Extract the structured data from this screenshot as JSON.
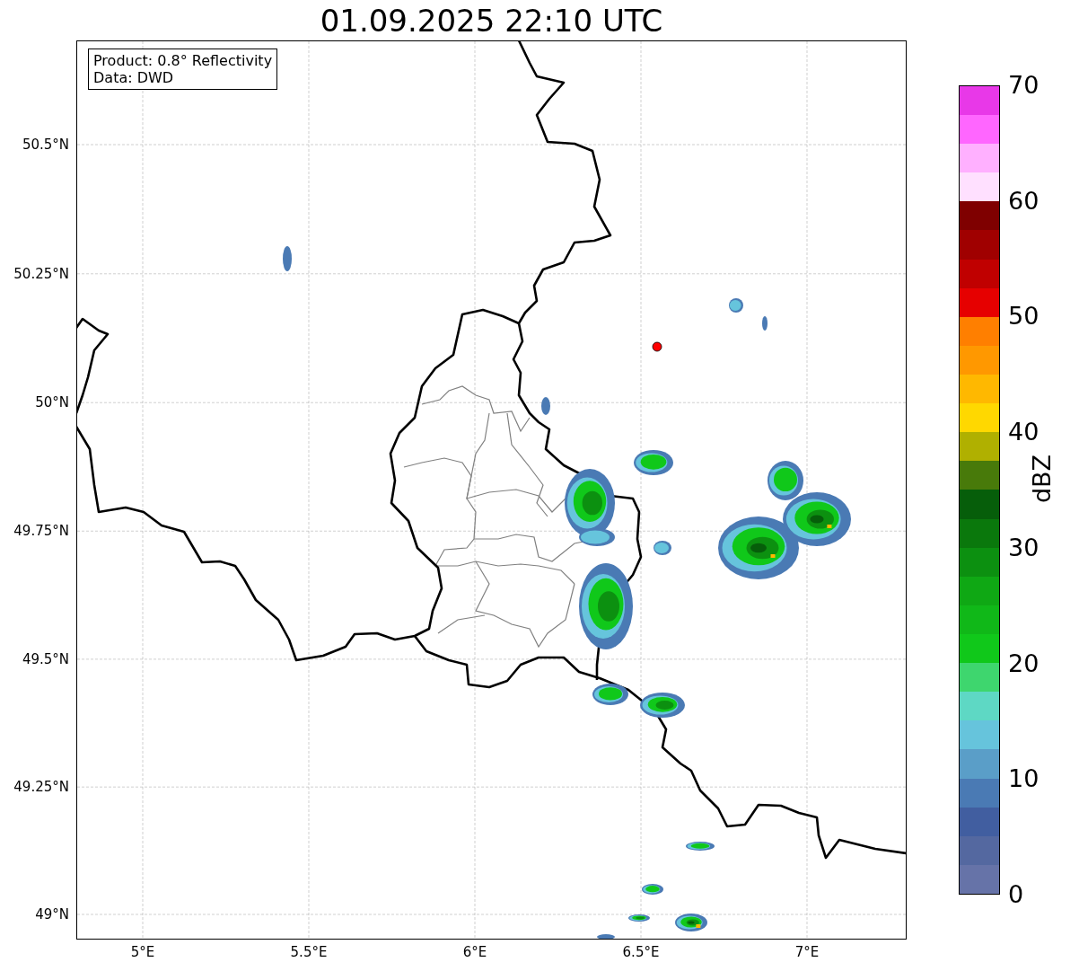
{
  "title": "01.09.2025 22:10 UTC",
  "info_box": {
    "lines": [
      "Product: 0.8° Reflectivity",
      "Data: DWD"
    ]
  },
  "map": {
    "lat_ticks": [
      "50.5°N",
      "50.25°N",
      "50°N",
      "49.75°N",
      "49.5°N",
      "49.25°N",
      "49°N"
    ],
    "lon_ticks": [
      "5°E",
      "5.5°E",
      "6°E",
      "6.5°E",
      "7°E"
    ]
  },
  "colorbar": {
    "label": "dBZ",
    "ticks": [
      "70",
      "60",
      "50",
      "40",
      "30",
      "20",
      "10",
      "0"
    ],
    "segments": [
      {
        "color": "#6673a8"
      },
      {
        "color": "#5468a0"
      },
      {
        "color": "#415ea0"
      },
      {
        "color": "#4a7ab4"
      },
      {
        "color": "#5a9ec8"
      },
      {
        "color": "#66c4dc"
      },
      {
        "color": "#5ed8c4"
      },
      {
        "color": "#3ed66e"
      },
      {
        "color": "#10c81a"
      },
      {
        "color": "#10b818"
      },
      {
        "color": "#0fa814"
      },
      {
        "color": "#0c9010"
      },
      {
        "color": "#0a780c"
      },
      {
        "color": "#065e0a"
      },
      {
        "color": "#487a0a"
      },
      {
        "color": "#b0b000"
      },
      {
        "color": "#ffd800"
      },
      {
        "color": "#ffb800"
      },
      {
        "color": "#ff9800"
      },
      {
        "color": "#ff7f00"
      },
      {
        "color": "#e60000"
      },
      {
        "color": "#c00000"
      },
      {
        "color": "#a00000"
      },
      {
        "color": "#7f0000"
      },
      {
        "color": "#ffe0ff"
      },
      {
        "color": "#ffb0ff"
      },
      {
        "color": "#ff66ff"
      },
      {
        "color": "#e838e8"
      }
    ]
  }
}
